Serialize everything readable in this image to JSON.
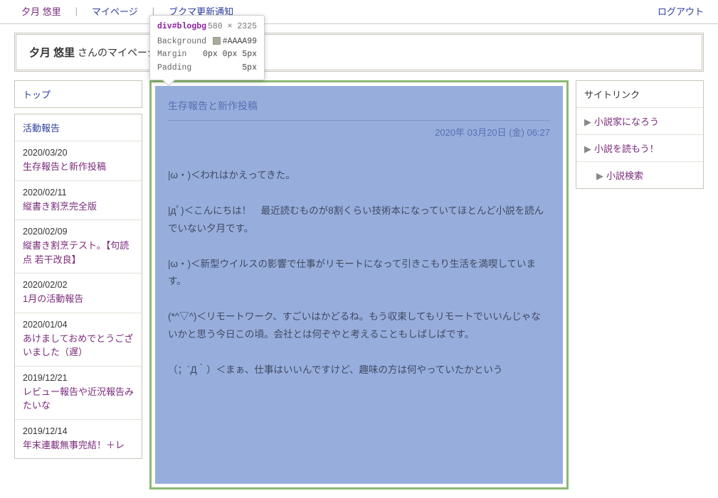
{
  "topnav": {
    "username": "夕月 悠里",
    "mypage": "マイページ",
    "bookmark": "ブクマ更新通知",
    "logout": "ログアウト"
  },
  "header": {
    "username": "夕月 悠里",
    "suffix": " さんのマイページ"
  },
  "left": {
    "top_label": "トップ",
    "activity_label": "活動報告",
    "posts": [
      {
        "date": "2020/03/20",
        "title": "生存報告と新作投稿"
      },
      {
        "date": "2020/02/11",
        "title": "縦書き割烹完全版"
      },
      {
        "date": "2020/02/09",
        "title": "縦書き割烹テスト。【句読点 若干改良】"
      },
      {
        "date": "2020/02/02",
        "title": "1月の活動報告"
      },
      {
        "date": "2020/01/04",
        "title": "あけましておめでとうございました（遅）"
      },
      {
        "date": "2019/12/21",
        "title": "レビュー報告や近況報告みたいな"
      },
      {
        "date": "2019/12/14",
        "title": "年末連載無事完結！＋レ"
      }
    ]
  },
  "right": {
    "header": "サイトリンク",
    "links": [
      {
        "label": "小説家になろう",
        "sub": false
      },
      {
        "label": "小説を読もう！",
        "sub": false
      },
      {
        "label": "小説検索",
        "sub": true
      }
    ]
  },
  "blog": {
    "title": "生存報告と新作投稿",
    "date": "2020年 03月20日 (金) 06:27",
    "paragraphs": [
      "|ω・)＜われはかえってきた。",
      "|дﾟ)＜こんにちは！　最近読むものが8割くらい技術本になっていてほとんど小説を読んでいない夕月です。",
      "|ω・)＜新型ウイルスの影響で仕事がリモートになって引きこもり生活を満喫しています。",
      "(*^▽^)＜リモートワーク、すごいはかどるね。もう収束してもリモートでいいんじゃないかと思う今日この頃。会社とは何ぞやと考えることもしばしばです。",
      "（；´Д｀）＜まぁ、仕事はいいんですけど、趣味の方は何やっていたかという"
    ]
  },
  "tooltip": {
    "selector": "div#blogbg",
    "dims": "580 × 2325",
    "rows": [
      {
        "k": "Background",
        "v": "#AAAA99",
        "swatch": "#AAAA99"
      },
      {
        "k": "Margin",
        "v": "0px 0px 5px"
      },
      {
        "k": "Padding",
        "v": "5px"
      }
    ]
  }
}
